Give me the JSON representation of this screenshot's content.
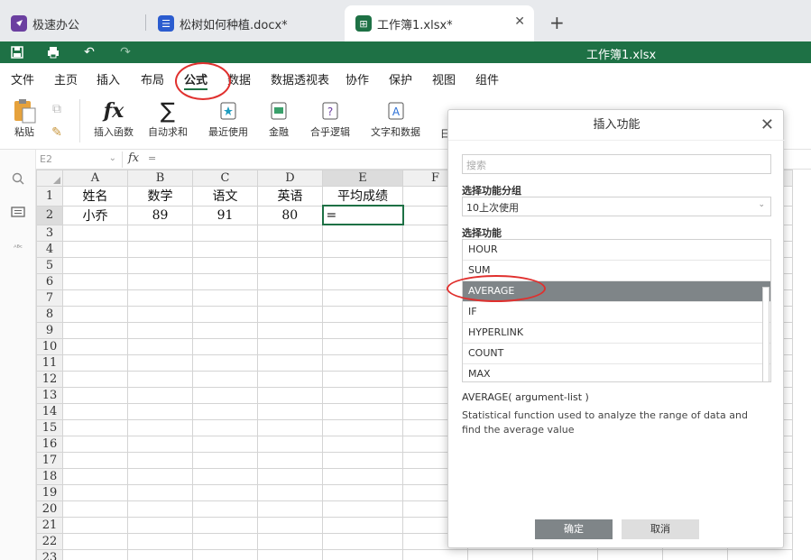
{
  "tabs": [
    {
      "label": "极速办公",
      "icon": "rocket-icon",
      "color": "#6b3fa0"
    },
    {
      "label": "松树如何种植.docx*",
      "icon": "document-icon",
      "color": "#2b5ccf"
    },
    {
      "label": "工作簿1.xlsx*",
      "icon": "spreadsheet-icon",
      "color": "#1e7145",
      "active": true
    }
  ],
  "titlebar": {
    "title": "工作簿1.xlsx",
    "color": "#1e7145"
  },
  "menu": [
    "文件",
    "主页",
    "插入",
    "布局",
    "公式",
    "数据",
    "数据透视表",
    "协作",
    "保护",
    "视图",
    "组件"
  ],
  "active_menu": "公式",
  "ribbon": {
    "paste": "粘贴",
    "insert_function": "插入函数",
    "autosum": "自动求和",
    "recent": "最近使用",
    "financial": "金融",
    "logical": "合乎逻辑",
    "text_data": "文字和数据",
    "more": "日"
  },
  "formula_bar": {
    "cell_ref": "E2",
    "fx": "fx",
    "content": "="
  },
  "sheet": {
    "columns": [
      "A",
      "B",
      "C",
      "D",
      "E",
      "F"
    ],
    "selected_column": "E",
    "selected_row": "2",
    "rows": [
      {
        "num": "1",
        "cells": [
          "姓名",
          "数学",
          "语文",
          "英语",
          "平均成绩",
          ""
        ]
      },
      {
        "num": "2",
        "cells": [
          "小乔",
          "89",
          "91",
          "80",
          "=",
          ""
        ]
      },
      {
        "num": "3",
        "cells": [
          "",
          "",
          "",
          "",
          "",
          ""
        ]
      },
      {
        "num": "4",
        "cells": [
          "",
          "",
          "",
          "",
          "",
          ""
        ]
      },
      {
        "num": "5",
        "cells": [
          "",
          "",
          "",
          "",
          "",
          ""
        ]
      },
      {
        "num": "6",
        "cells": [
          "",
          "",
          "",
          "",
          "",
          ""
        ]
      },
      {
        "num": "7",
        "cells": [
          "",
          "",
          "",
          "",
          "",
          ""
        ]
      },
      {
        "num": "8",
        "cells": [
          "",
          "",
          "",
          "",
          "",
          ""
        ]
      },
      {
        "num": "9",
        "cells": [
          "",
          "",
          "",
          "",
          "",
          ""
        ]
      },
      {
        "num": "10",
        "cells": [
          "",
          "",
          "",
          "",
          "",
          ""
        ]
      },
      {
        "num": "11",
        "cells": [
          "",
          "",
          "",
          "",
          "",
          ""
        ]
      },
      {
        "num": "12",
        "cells": [
          "",
          "",
          "",
          "",
          "",
          ""
        ]
      },
      {
        "num": "13",
        "cells": [
          "",
          "",
          "",
          "",
          "",
          ""
        ]
      },
      {
        "num": "14",
        "cells": [
          "",
          "",
          "",
          "",
          "",
          ""
        ]
      },
      {
        "num": "15",
        "cells": [
          "",
          "",
          "",
          "",
          "",
          ""
        ]
      },
      {
        "num": "16",
        "cells": [
          "",
          "",
          "",
          "",
          "",
          ""
        ]
      },
      {
        "num": "17",
        "cells": [
          "",
          "",
          "",
          "",
          "",
          ""
        ]
      },
      {
        "num": "18",
        "cells": [
          "",
          "",
          "",
          "",
          "",
          ""
        ]
      },
      {
        "num": "19",
        "cells": [
          "",
          "",
          "",
          "",
          "",
          ""
        ]
      },
      {
        "num": "20",
        "cells": [
          "",
          "",
          "",
          "",
          "",
          ""
        ]
      },
      {
        "num": "21",
        "cells": [
          "",
          "",
          "",
          "",
          "",
          ""
        ]
      },
      {
        "num": "22",
        "cells": [
          "",
          "",
          "",
          "",
          "",
          ""
        ]
      },
      {
        "num": "23",
        "cells": [
          "",
          "",
          "",
          "",
          "",
          ""
        ]
      }
    ]
  },
  "dialog": {
    "title": "插入功能",
    "search_placeholder": "搜索",
    "group_label": "选择功能分组",
    "group_value": "10上次使用",
    "function_label": "选择功能",
    "functions": [
      "HOUR",
      "SUM",
      "AVERAGE",
      "IF",
      "HYPERLINK",
      "COUNT",
      "MAX"
    ],
    "selected_function": "AVERAGE",
    "signature": "AVERAGE( argument-list )",
    "description": "Statistical function used to analyze the range of data and find the average value",
    "ok": "确定",
    "cancel": "取消"
  },
  "colors": {
    "accent": "#1e7145",
    "selection": "#7f8588",
    "annotation": "#e0302e"
  }
}
